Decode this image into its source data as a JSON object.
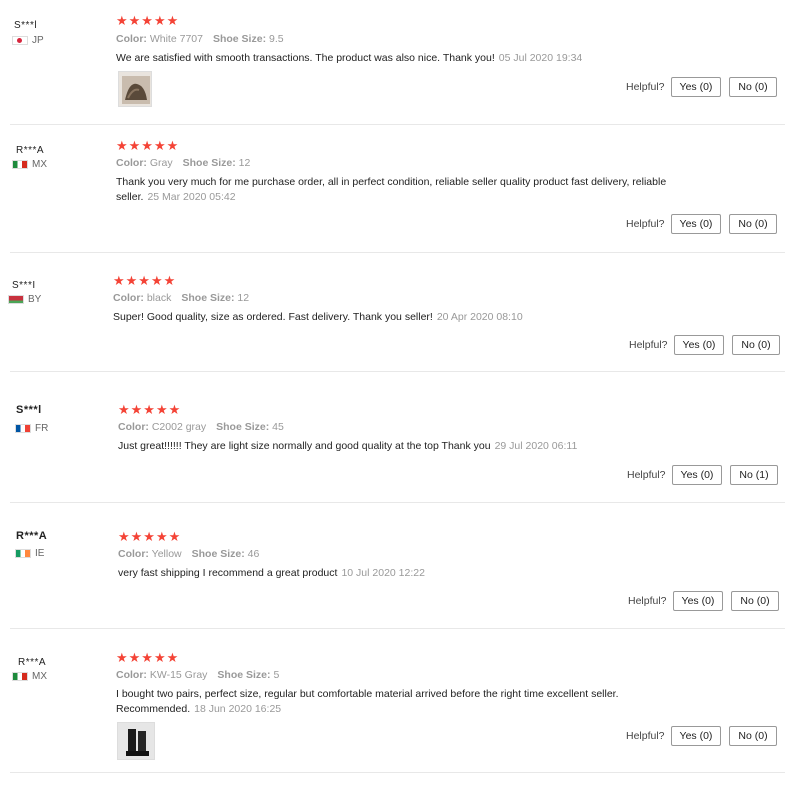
{
  "labels": {
    "color": "Color:",
    "shoe_size": "Shoe Size:",
    "helpful": "Helpful?"
  },
  "star_rating_max": 5,
  "reviews": [
    {
      "user": "S***l",
      "country": "JP",
      "rating": 5,
      "color": "White 7707",
      "shoe_size": "9.5",
      "text": "We are satisfied with smooth transactions. The product was also nice. Thank you!",
      "date": "05 Jul 2020 19:34",
      "yes": "Yes (0)",
      "no": "No (0)",
      "has_photo": true
    },
    {
      "user": "R***A",
      "country": "MX",
      "rating": 5,
      "color": "Gray",
      "shoe_size": "12",
      "text": "Thank you very much for me purchase order, all in perfect condition, reliable seller quality product fast delivery, reliable seller.",
      "date": "25 Mar 2020 05:42",
      "yes": "Yes (0)",
      "no": "No (0)",
      "has_photo": false
    },
    {
      "user": "S***I",
      "country": "BY",
      "rating": 5,
      "color": "black",
      "shoe_size": "12",
      "text": "Super! Good quality, size as ordered. Fast delivery. Thank you seller!",
      "date": "20 Apr 2020 08:10",
      "yes": "Yes (0)",
      "no": "No (0)",
      "has_photo": false
    },
    {
      "user": "S***l",
      "country": "FR",
      "rating": 5,
      "color": "C2002 gray",
      "shoe_size": "45",
      "text": "Just great!!!!!! They are light size normally and good quality at the top Thank you",
      "date": "29 Jul 2020 06:11",
      "yes": "Yes (0)",
      "no": "No (1)",
      "has_photo": false
    },
    {
      "user": "R***A",
      "country": "IE",
      "rating": 5,
      "color": "Yellow",
      "shoe_size": "46",
      "text": "very fast shipping I recommend a great product",
      "date": "10 Jul 2020 12:22",
      "yes": "Yes (0)",
      "no": "No (0)",
      "has_photo": false
    },
    {
      "user": "R***A",
      "country": "MX",
      "rating": 5,
      "color": "KW-15 Gray",
      "shoe_size": "5",
      "text": "I bought two pairs, perfect size, regular but comfortable material arrived before the right time excellent seller. Recommended.",
      "date": "18 Jun 2020 16:25",
      "yes": "Yes (0)",
      "no": "No (0)",
      "has_photo": true
    }
  ],
  "flag_colors": {
    "JP": [
      "#ffffff",
      "#d7263d"
    ],
    "MX": [
      "#1e8a3c",
      "#ffffff",
      "#d52b1e"
    ],
    "BY": [
      "#c8313e",
      "#4aa657"
    ],
    "FR": [
      "#0055a4",
      "#ffffff",
      "#ef4135"
    ],
    "IE": [
      "#169b62",
      "#ffffff",
      "#ff883e"
    ]
  },
  "accent_star_color": "#f44336"
}
